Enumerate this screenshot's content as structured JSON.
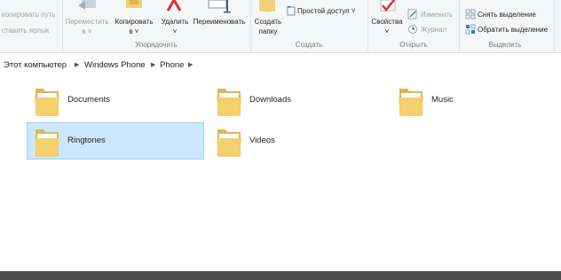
{
  "ribbon": {
    "clipboard": {
      "copy_path": "копировать путь",
      "paste_shortcut": "ставить ярлык"
    },
    "organize": {
      "move_to": "Переместить",
      "move_to_arrow": "в ˅",
      "copy_to": "Копировать",
      "copy_to_arrow": "в ˅",
      "delete": "Удалить",
      "delete_arrow": "˅",
      "rename": "Переименовать",
      "group_label": "Упорядочить"
    },
    "new": {
      "new_folder_line1": "Создать",
      "new_folder_line2": "папку",
      "easy_access": "Простой доступ ˅",
      "group_label": "Создать"
    },
    "open": {
      "properties": "Свойства",
      "properties_arrow": "˅",
      "edit": "Изменить",
      "history": "Журнал",
      "group_label": "Открыть"
    },
    "select": {
      "select_none": "Снять выделение",
      "invert_selection": "Обратить выделение",
      "group_label": "Выделить"
    }
  },
  "address": {
    "crumbs": [
      "Этот компьютер",
      "Windows Phone",
      "Phone"
    ]
  },
  "folders": [
    {
      "name": "Documents",
      "selected": false
    },
    {
      "name": "Downloads",
      "selected": false
    },
    {
      "name": "Music",
      "selected": false
    },
    {
      "name": "Ringtones",
      "selected": true
    },
    {
      "name": "Videos",
      "selected": false
    }
  ],
  "colors": {
    "selection_fill": "#cce8ff",
    "selection_border": "#99d1ff",
    "folder_yellow": "#f4d06f",
    "taskbar": "#4e4e4e"
  }
}
